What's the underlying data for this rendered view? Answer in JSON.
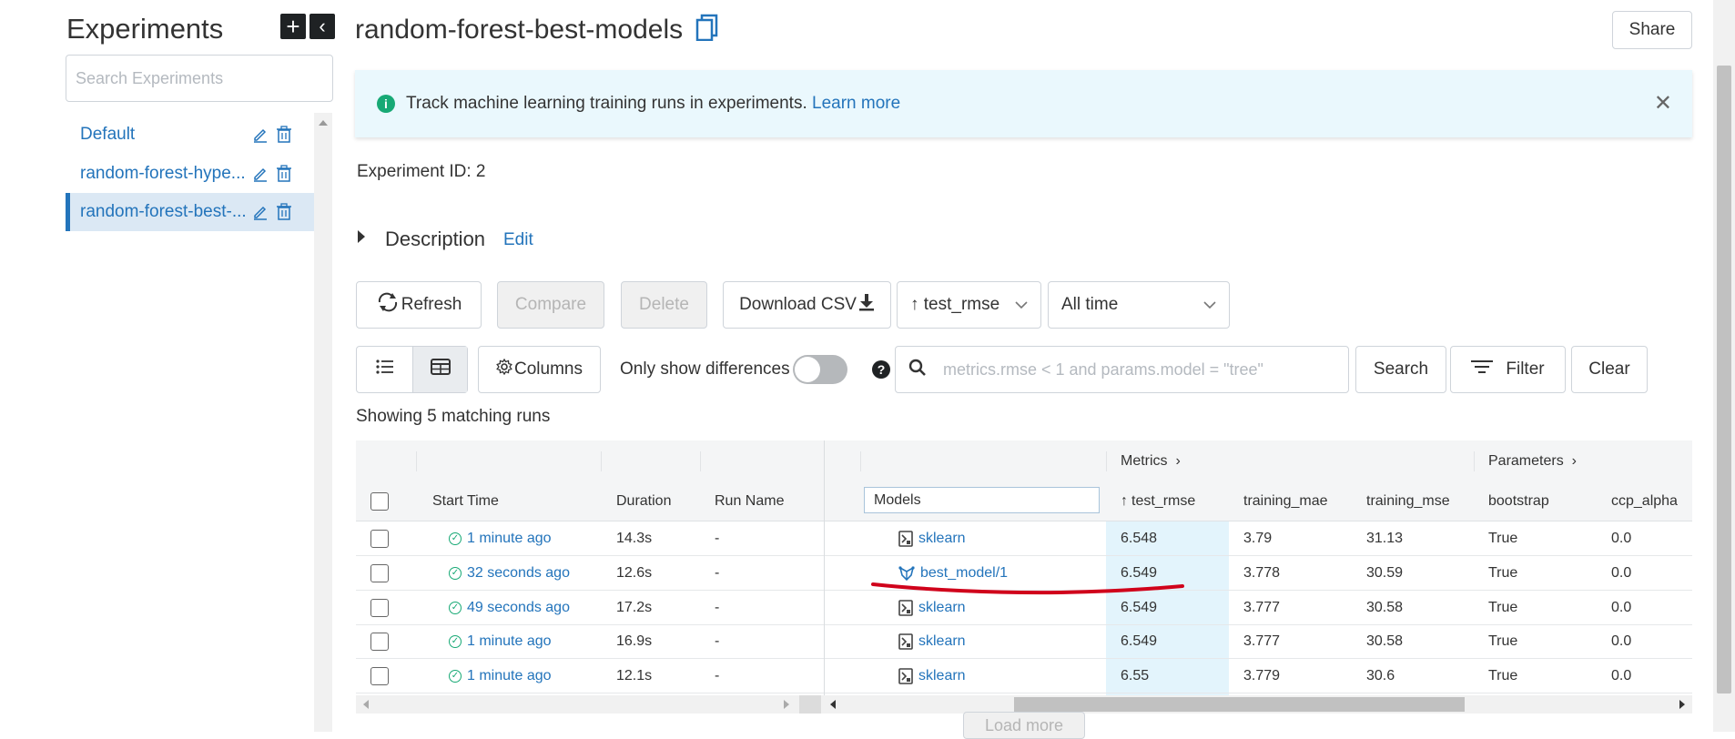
{
  "sidebar": {
    "title": "Experiments",
    "search_placeholder": "Search Experiments",
    "items": [
      {
        "label": "Default"
      },
      {
        "label": "random-forest-hype..."
      },
      {
        "label": "random-forest-best-..."
      }
    ]
  },
  "header": {
    "title": "random-forest-best-models",
    "share_label": "Share"
  },
  "banner": {
    "text": "Track machine learning training runs in experiments.",
    "link": "Learn more"
  },
  "experiment_id": "Experiment ID: 2",
  "description": {
    "label": "Description",
    "edit": "Edit"
  },
  "toolbar": {
    "refresh": "Refresh",
    "compare": "Compare",
    "delete": "Delete",
    "download": "Download CSV",
    "sort_label": "test_rmse",
    "time_range": "All time",
    "columns": "Columns",
    "only_diff": "Only show differences",
    "search_placeholder": "metrics.rmse < 1 and params.model = \"tree\"",
    "search_btn": "Search",
    "filter_btn": "Filter",
    "clear_btn": "Clear"
  },
  "matching": "Showing 5 matching runs",
  "table": {
    "group_headers": {
      "metrics": "Metrics",
      "parameters": "Parameters"
    },
    "columns": [
      "Start Time",
      "Duration",
      "Run Name",
      "Models",
      "test_rmse",
      "training_mae",
      "training_mse",
      "bootstrap",
      "ccp_alpha"
    ],
    "rows": [
      {
        "start": "1 minute ago",
        "duration": "14.3s",
        "run": "-",
        "model": "sklearn",
        "test_rmse": "6.548",
        "training_mae": "3.79",
        "training_mse": "31.13",
        "bootstrap": "True",
        "ccp_alpha": "0.0"
      },
      {
        "start": "32 seconds ago",
        "duration": "12.6s",
        "run": "-",
        "model": "best_model/1",
        "test_rmse": "6.549",
        "training_mae": "3.778",
        "training_mse": "30.59",
        "bootstrap": "True",
        "ccp_alpha": "0.0"
      },
      {
        "start": "49 seconds ago",
        "duration": "17.2s",
        "run": "-",
        "model": "sklearn",
        "test_rmse": "6.549",
        "training_mae": "3.777",
        "training_mse": "30.58",
        "bootstrap": "True",
        "ccp_alpha": "0.0"
      },
      {
        "start": "1 minute ago",
        "duration": "16.9s",
        "run": "-",
        "model": "sklearn",
        "test_rmse": "6.549",
        "training_mae": "3.777",
        "training_mse": "30.58",
        "bootstrap": "True",
        "ccp_alpha": "0.0"
      },
      {
        "start": "1 minute ago",
        "duration": "12.1s",
        "run": "-",
        "model": "sklearn",
        "test_rmse": "6.55",
        "training_mae": "3.779",
        "training_mse": "30.6",
        "bootstrap": "True",
        "ccp_alpha": "0.0"
      }
    ]
  },
  "load_more": "Load more",
  "colors": {
    "accent": "#2374bb",
    "success": "#17a975",
    "highlight": "#e3f4fc",
    "annotation": "#d0021b"
  },
  "icons": [
    "plus-icon",
    "collapse-icon",
    "edit-icon",
    "trash-icon",
    "copy-icon",
    "info-icon",
    "close-icon",
    "refresh-icon",
    "download-icon",
    "sort-up-icon",
    "chevron-down-icon",
    "list-view-icon",
    "table-view-icon",
    "gear-icon",
    "help-icon",
    "search-icon",
    "filter-icon",
    "check-circle-icon",
    "sklearn-icon",
    "registered-model-icon"
  ]
}
